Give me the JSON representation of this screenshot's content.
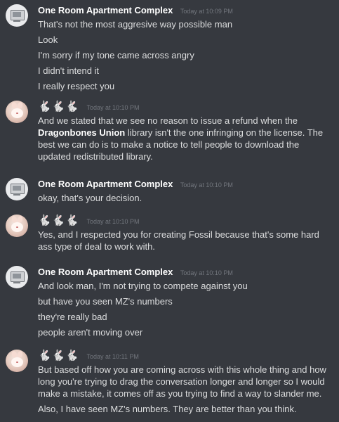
{
  "messages": [
    {
      "author": "One Room Apartment Complex",
      "author_kind": "name",
      "avatar": "desktop-computer-avatar",
      "timestamp": "Today at 10:09 PM",
      "lines": [
        "That's not the most aggresive way possible man",
        "Look",
        "I'm sorry if my tone came across angry",
        "I didn't intend it",
        "I really respect you"
      ]
    },
    {
      "author": "🐇🐇🐇",
      "author_kind": "rabbit-emoji",
      "avatar": "bunny-avatar",
      "timestamp": "Today at 10:10 PM",
      "lines": [
        {
          "before": "And we stated that we see no reason to issue a refund when the ",
          "bold": "Dragonbones Union",
          "after": " library isn't the one infringing on the license. The best we can do is to make a notice to tell people to download the updated redistributed library."
        }
      ]
    },
    {
      "author": "One Room Apartment Complex",
      "author_kind": "name",
      "avatar": "desktop-computer-avatar",
      "timestamp": "Today at 10:10 PM",
      "lines": [
        "okay, that's your decision."
      ]
    },
    {
      "author": "🐇🐇🐇",
      "author_kind": "rabbit-emoji",
      "avatar": "bunny-avatar",
      "timestamp": "Today at 10:10 PM",
      "lines": [
        "Yes, and I respected you for creating Fossil because that's some hard ass type of deal to work with."
      ]
    },
    {
      "author": "One Room Apartment Complex",
      "author_kind": "name",
      "avatar": "desktop-computer-avatar",
      "timestamp": "Today at 10:10 PM",
      "lines": [
        "And look man, I'm not trying to compete against you",
        "but have you seen MZ's numbers",
        "they're really bad",
        "people aren't moving over"
      ]
    },
    {
      "author": "🐇🐇🐇",
      "author_kind": "rabbit-emoji",
      "avatar": "bunny-avatar",
      "timestamp": "Today at 10:11 PM",
      "lines": [
        "But based off how you are coming across with this whole thing and how long you're trying to drag the conversation longer and longer so I would make a mistake, it comes off as you trying to find a way to slander me.",
        "Also, I have seen MZ's numbers. They are better than you think."
      ]
    }
  ]
}
